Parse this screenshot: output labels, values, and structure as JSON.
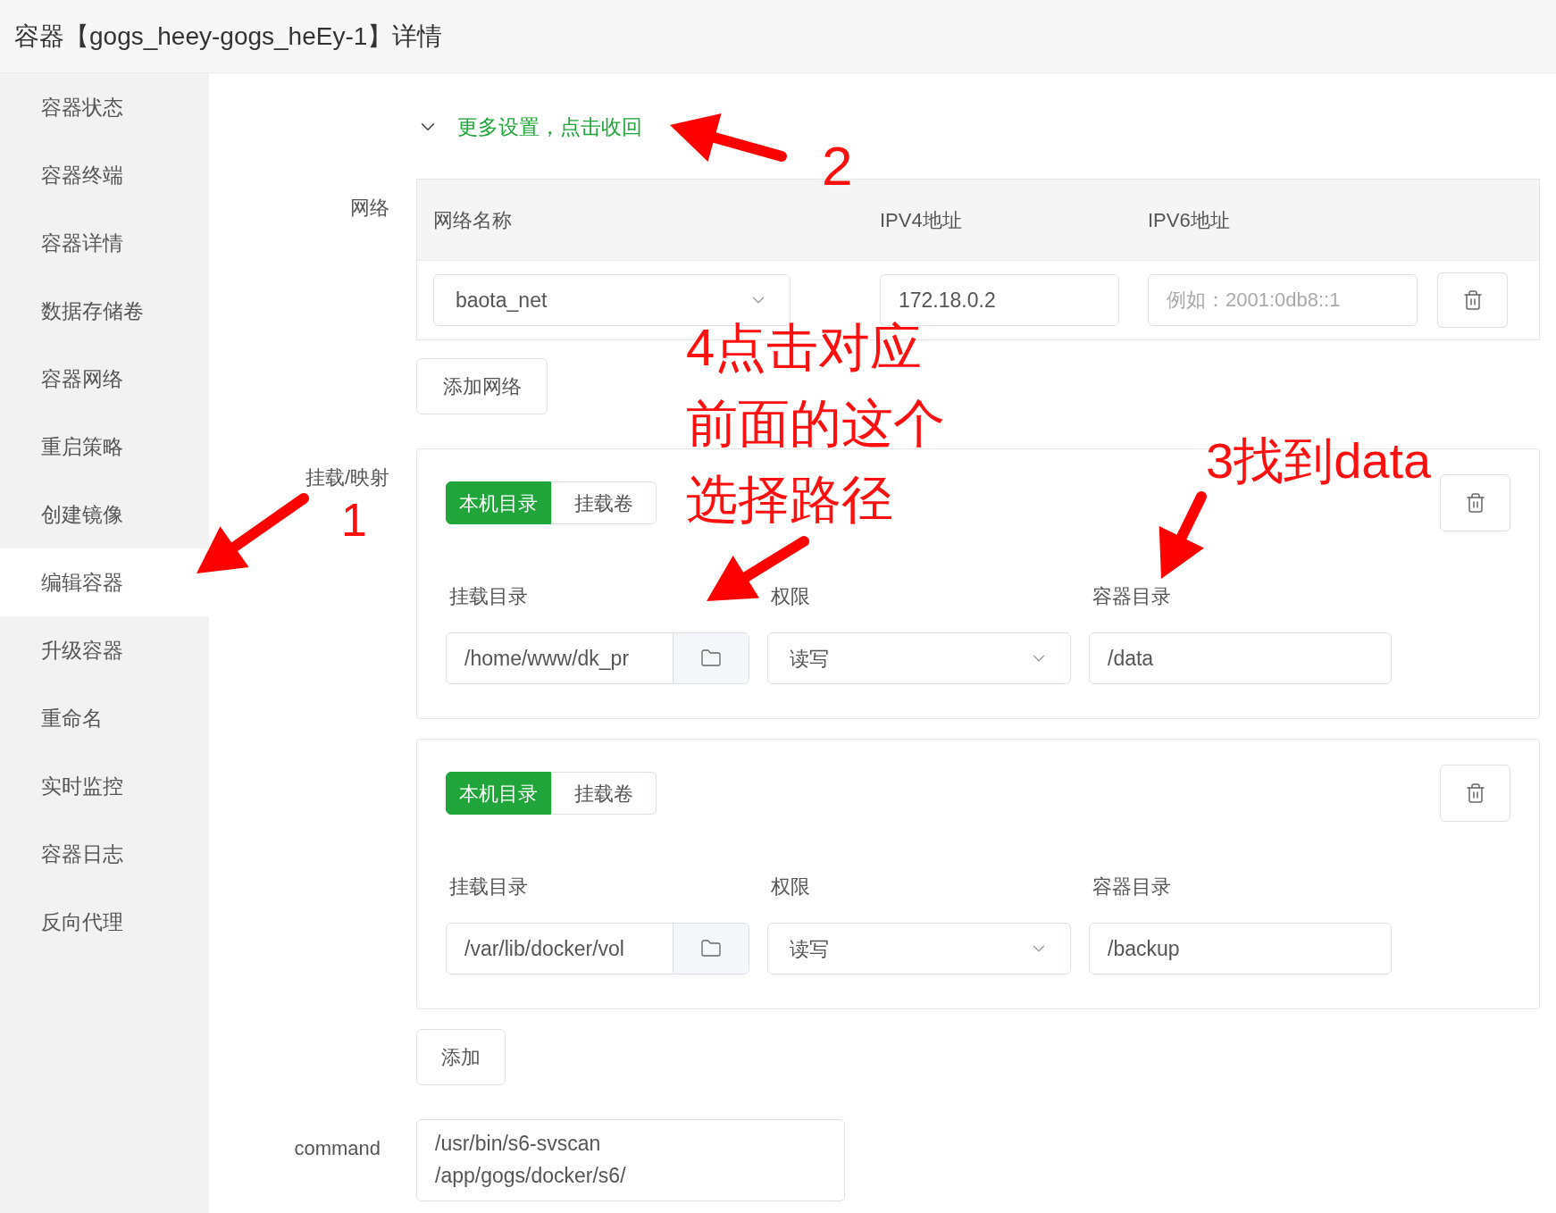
{
  "header": {
    "title": "容器【gogs_heey-gogs_heEy-1】详情"
  },
  "sidebar": {
    "items": [
      {
        "label": "容器状态",
        "selected": false
      },
      {
        "label": "容器终端",
        "selected": false
      },
      {
        "label": "容器详情",
        "selected": false
      },
      {
        "label": "数据存储卷",
        "selected": false
      },
      {
        "label": "容器网络",
        "selected": false
      },
      {
        "label": "重启策略",
        "selected": false
      },
      {
        "label": "创建镜像",
        "selected": false
      },
      {
        "label": "编辑容器",
        "selected": true
      },
      {
        "label": "升级容器",
        "selected": false
      },
      {
        "label": "重命名",
        "selected": false
      },
      {
        "label": "实时监控",
        "selected": false
      },
      {
        "label": "容器日志",
        "selected": false
      },
      {
        "label": "反向代理",
        "selected": false
      }
    ]
  },
  "more_settings": {
    "label": "更多设置，点击收回",
    "expanded": true
  },
  "network": {
    "label": "网络",
    "columns": [
      "网络名称",
      "IPV4地址",
      "IPV6地址"
    ],
    "rows": [
      {
        "network": "baota_net",
        "ipv4": "172.18.0.2",
        "ipv6_placeholder": "例如：2001:0db8::1"
      }
    ],
    "add_button": "添加网络"
  },
  "mounts": {
    "label": "挂载/映射",
    "items": [
      {
        "tabs": [
          {
            "label": "本机目录",
            "selected": true
          },
          {
            "label": "挂载卷",
            "selected": false
          }
        ],
        "host_dir_label": "挂载目录",
        "host_dir": "/home/www/dk_pr",
        "permission_label": "权限",
        "permission": "读写",
        "container_dir_label": "容器目录",
        "container_dir": "/data"
      },
      {
        "tabs": [
          {
            "label": "本机目录",
            "selected": true
          },
          {
            "label": "挂载卷",
            "selected": false
          }
        ],
        "host_dir_label": "挂载目录",
        "host_dir": "/var/lib/docker/vol",
        "permission_label": "权限",
        "permission": "读写",
        "container_dir_label": "容器目录",
        "container_dir": "/backup"
      }
    ],
    "add_button": "添加"
  },
  "command": {
    "label": "command",
    "lines": [
      "/usr/bin/s6-svscan",
      "/app/gogs/docker/s6/"
    ]
  },
  "annotations": [
    {
      "text": "1"
    },
    {
      "text": "2"
    },
    {
      "text": "3找到data"
    },
    {
      "lines": [
        "4点击对应",
        "前面的这个",
        "选择路径"
      ]
    }
  ]
}
